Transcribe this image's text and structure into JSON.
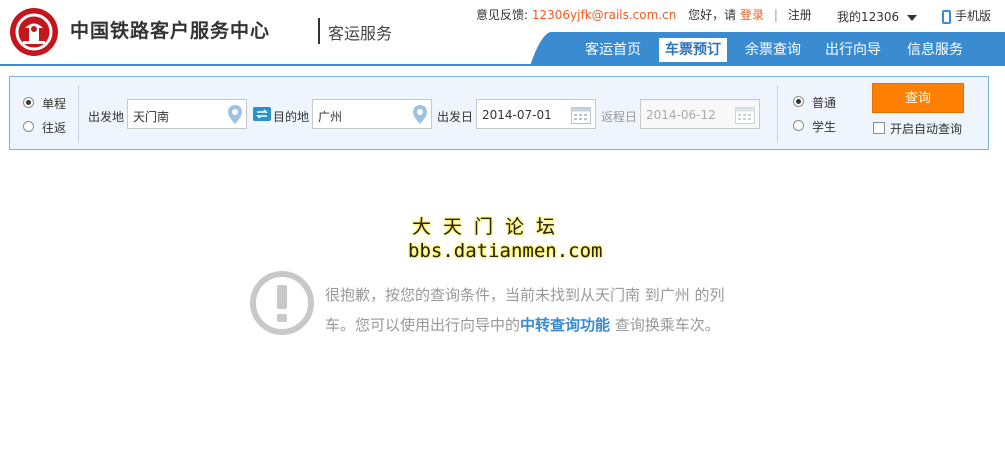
{
  "header": {
    "org_name": "中国铁路客户服务中心",
    "sub_name": "客运服务",
    "feedback_label": "意见反馈:",
    "feedback_email": "12306yjfk@rails.com.cn",
    "greeting": "您好，请",
    "login": "登录",
    "separator": "|",
    "register": "注册",
    "my12306": "我的12306",
    "mobile": "手机版"
  },
  "nav": {
    "items": [
      {
        "label": "客运首页",
        "active": false
      },
      {
        "label": "车票预订",
        "active": true
      },
      {
        "label": "余票查询",
        "active": false
      },
      {
        "label": "出行向导",
        "active": false
      },
      {
        "label": "信息服务",
        "active": false
      }
    ]
  },
  "search": {
    "trip_type": {
      "one_way": "单程",
      "round_trip": "往返",
      "selected": "one_way"
    },
    "from_label": "出发地",
    "from_value": "天门南",
    "to_label": "目的地",
    "to_value": "广州",
    "depart_label": "出发日",
    "depart_value": "2014-07-01",
    "return_label": "返程日",
    "return_value": "2014-06-12",
    "passenger": {
      "normal": "普通",
      "student": "学生",
      "selected": "normal"
    },
    "query_button": "查询",
    "auto_query": "开启自动查询"
  },
  "watermark": {
    "line1": "大天门论坛",
    "line2": "bbs.datianmen.com"
  },
  "result": {
    "part1": "很抱歉，按您的查询条件，当前未找到从天门南 到广州 的列车。您可以使用出行向导中的",
    "link": "中转查询功能",
    "part2": " 查询换乘车次。"
  },
  "colors": {
    "brand_red": "#c4161c",
    "nav_blue": "#3b8bd1",
    "accent_orange": "#ff7f00",
    "panel_bg": "#eef5fc"
  }
}
